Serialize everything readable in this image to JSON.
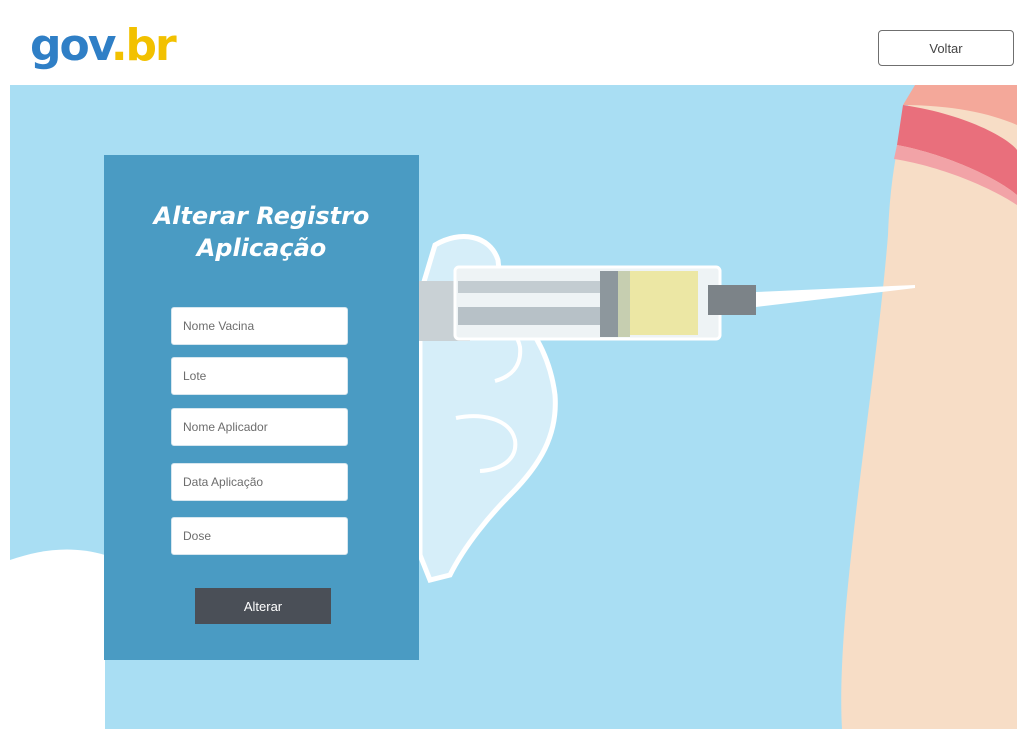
{
  "header": {
    "logo": {
      "part1": "gov",
      "part2": ".br"
    },
    "back_label": "Voltar"
  },
  "form": {
    "title_line1": "Alterar Registro",
    "title_line2": "Aplicação",
    "fields": [
      {
        "placeholder": "Nome Vacina",
        "value": ""
      },
      {
        "placeholder": "Lote",
        "value": ""
      },
      {
        "placeholder": "Nome Aplicador",
        "value": ""
      },
      {
        "placeholder": "Data Aplicação",
        "value": ""
      },
      {
        "placeholder": "Dose",
        "value": ""
      }
    ],
    "submit_label": "Alterar"
  },
  "colors": {
    "background_sky": "#a9def3",
    "card": "#4a9bc3",
    "button_dark": "#4a4f57",
    "logo_blue": "#2f7fc6",
    "logo_yellow": "#f2c100",
    "logo_green": "#2fa84f"
  },
  "icons": [
    "syringe-illustration",
    "gloved-hand-illustration",
    "arm-illustration"
  ]
}
